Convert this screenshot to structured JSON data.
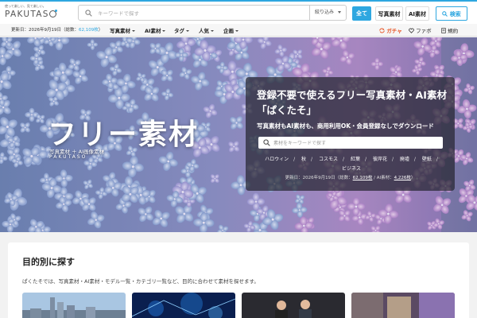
{
  "header": {
    "logo_tagline": "使って楽しい、見て楽しい。",
    "logo_word": "PAKUTAS",
    "search_placeholder": "キーワードで探す",
    "filter_label": "絞り込み",
    "buttons": {
      "all": "全て",
      "photo": "写真素材",
      "ai": "AI素材",
      "search": "検索"
    }
  },
  "subnav": {
    "updated_prefix": "更新日：2026年9月19日（総数：",
    "updated_count": "62,109枚",
    "updated_suffix": "）",
    "items": [
      "写真素材",
      "AI素材",
      "タグ",
      "人気",
      "企画"
    ],
    "gacha": "ガチャ",
    "fav": "ファボ",
    "terms": "規約"
  },
  "hero": {
    "title": "フリー素材",
    "subtitle": "写真素材 ＋ AI画像素材",
    "brand": "PAKUTASO",
    "panel": {
      "heading": "登録不要で使えるフリー写真素材・AI素材「ぱくたそ」",
      "subheading": "写真素材もAI素材も、商用利用OK・会員登録なしでダウンロード",
      "search_placeholder": "素材をキーワードで探す",
      "tags": [
        "ハロウィン",
        "秋",
        "コスモス",
        "紅葉",
        "彼岸花",
        "廃墟",
        "壁紙",
        "ビジネス"
      ],
      "stat_prefix": "更新日：2026年9月19日（総数：",
      "stat_total": "62,109枚",
      "stat_mid": " / AI素材：",
      "stat_ai": "4,226枚",
      "stat_suffix": "）"
    }
  },
  "purpose": {
    "title": "目的別に探す",
    "description": "ぱくたそでは、写真素材・AI素材・モデル一覧・カテゴリ一覧など、目的に合わせて素材を探せます。"
  },
  "colors": {
    "accent": "#2ea7e0",
    "gacha": "#e8592b"
  }
}
